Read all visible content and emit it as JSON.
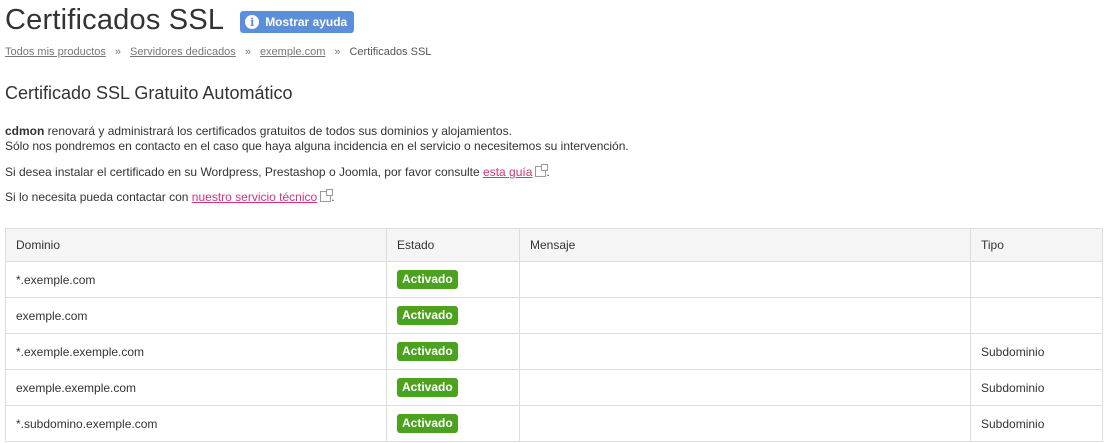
{
  "header": {
    "title": "Certificados SSL",
    "help_label": "Mostrar ayuda",
    "help_icon": "info-icon"
  },
  "breadcrumb": {
    "items": [
      "Todos mis productos",
      "Servidores dedicados",
      "exemple.com",
      "Certificados SSL"
    ],
    "separator": "»"
  },
  "section": {
    "title": "Certificado SSL Gratuito Automático",
    "brand": "cdmon",
    "line1": " renovará y administrará los certificados gratuitos de todos sus dominios y alojamientos.",
    "line2": "Sólo nos pondremos en contacto en el caso que haya alguna incidencia en el servicio o necesitemos su intervención.",
    "guide_prefix": "Si desea instalar el certificado en su Wordpress, Prestashop o Joomla, por favor consulte ",
    "guide_link": "esta guía",
    "guide_suffix": ".",
    "support_prefix": "Si lo necesita pueda contactar con ",
    "support_link": "nuestro servicio técnico",
    "support_suffix": "."
  },
  "table": {
    "headers": [
      "Dominio",
      "Estado",
      "Mensaje",
      "Tipo"
    ],
    "rows": [
      {
        "domain": "*.exemple.com",
        "status": "Activado",
        "message": "",
        "type": ""
      },
      {
        "domain": "exemple.com",
        "status": "Activado",
        "message": "",
        "type": ""
      },
      {
        "domain": "*.exemple.exemple.com",
        "status": "Activado",
        "message": "",
        "type": "Subdominio"
      },
      {
        "domain": "exemple.exemple.com",
        "status": "Activado",
        "message": "",
        "type": "Subdominio"
      },
      {
        "domain": "*.subdomino.exemple.com",
        "status": "Activado",
        "message": "",
        "type": "Subdominio"
      }
    ]
  },
  "colors": {
    "help_button": "#5b8fd9",
    "status_badge": "#4ba21f",
    "link": "#d6337a"
  }
}
